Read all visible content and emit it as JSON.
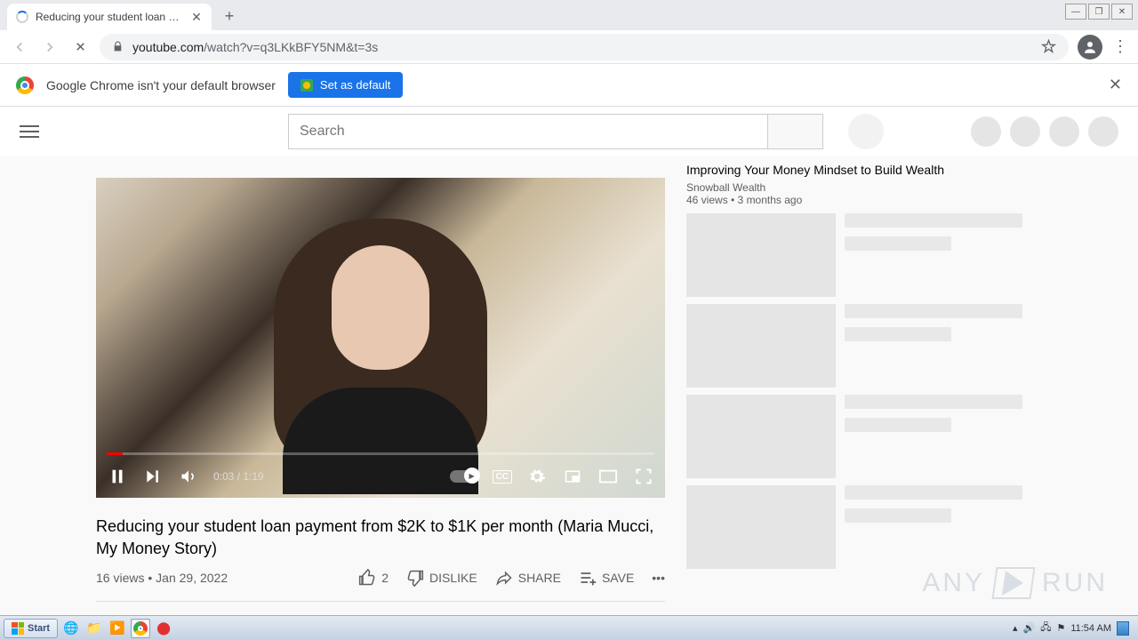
{
  "tab": {
    "title": "Reducing your student loan paymen"
  },
  "url": {
    "host": "youtube.com",
    "path": "/watch?v=q3LKkBFY5NM&t=3s"
  },
  "infobar": {
    "text": "Google Chrome isn't your default browser",
    "button": "Set as default"
  },
  "search": {
    "placeholder": "Search"
  },
  "player": {
    "time": "0:03 / 1:19",
    "cc": "CC"
  },
  "video": {
    "title": "Reducing your student loan payment from $2K to $1K per month (Maria Mucci, My Money Story)",
    "views": "16 views",
    "date": "Jan 29, 2022"
  },
  "actions": {
    "likes": "2",
    "dislike": "DISLIKE",
    "share": "SHARE",
    "save": "SAVE"
  },
  "related": {
    "first": {
      "title": "Improving Your Money Mindset to Build Wealth",
      "channel": "Snowball Wealth",
      "meta": "46 views • 3 months ago"
    }
  },
  "watermark": {
    "a": "ANY",
    "b": "RUN"
  },
  "taskbar": {
    "start": "Start",
    "clock": "11:54 AM"
  }
}
